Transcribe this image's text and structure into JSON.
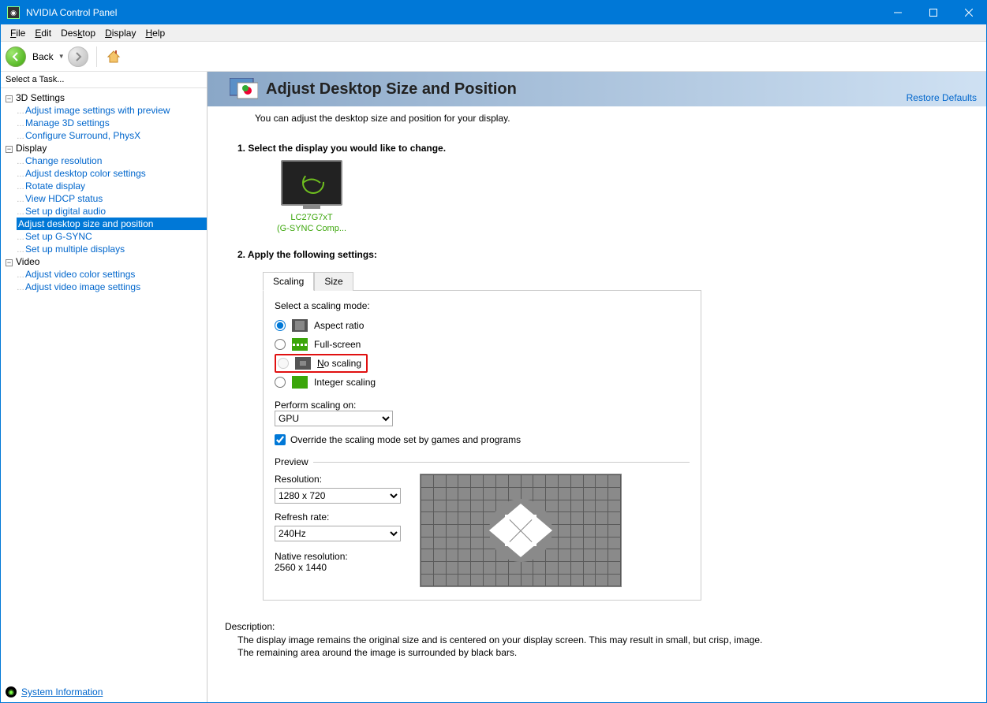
{
  "titlebar": {
    "title": "NVIDIA Control Panel"
  },
  "menu": {
    "file": "File",
    "edit": "Edit",
    "desktop": "Desktop",
    "display": "Display",
    "help": "Help"
  },
  "toolbar": {
    "back": "Back"
  },
  "sidebar": {
    "heading": "Select a Task...",
    "cat1": "3D Settings",
    "cat1_items": [
      "Adjust image settings with preview",
      "Manage 3D settings",
      "Configure Surround, PhysX"
    ],
    "cat2": "Display",
    "cat2_items": [
      "Change resolution",
      "Adjust desktop color settings",
      "Rotate display",
      "View HDCP status",
      "Set up digital audio",
      "Adjust desktop size and position",
      "Set up G-SYNC",
      "Set up multiple displays"
    ],
    "cat3": "Video",
    "cat3_items": [
      "Adjust video color settings",
      "Adjust video image settings"
    ],
    "sysinfo": "System Information"
  },
  "banner": {
    "title": "Adjust Desktop Size and Position",
    "restore": "Restore Defaults"
  },
  "intro": "You can adjust the desktop size and position for your display.",
  "step1": "1. Select the display you would like to change.",
  "display": {
    "name": "LC27G7xT",
    "sub": "(G-SYNC Comp..."
  },
  "step2": "2. Apply the following settings:",
  "tabs": {
    "scaling": "Scaling",
    "size": "Size"
  },
  "scaling": {
    "mode_label": "Select a scaling mode:",
    "aspect": "Aspect ratio",
    "full": "Full-screen",
    "none": "No scaling",
    "integer": "Integer scaling",
    "perform_label": "Perform scaling on:",
    "perform_value": "GPU",
    "override": "Override the scaling mode set by games and programs",
    "preview": "Preview",
    "res_label": "Resolution:",
    "res_value": "1280 x 720",
    "rate_label": "Refresh rate:",
    "rate_value": "240Hz",
    "native_label": "Native resolution:",
    "native_value": "2560 x 1440"
  },
  "desc": {
    "head": "Description:",
    "line1": "The display image remains the original size and is centered on your display screen. This may result in small, but crisp, image.",
    "line2": "The remaining area around the image is surrounded by black bars."
  }
}
